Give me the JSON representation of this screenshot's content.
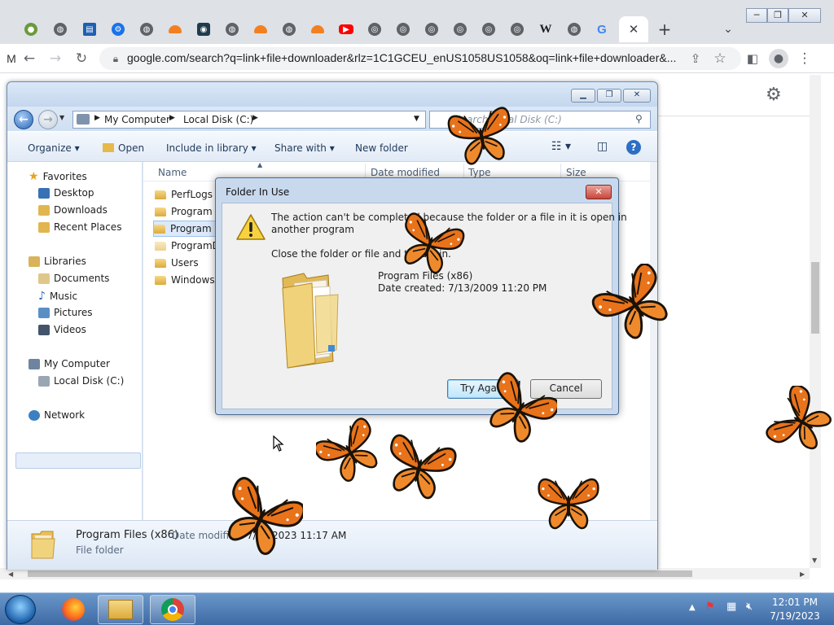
{
  "browser": {
    "url": "google.com/search?q=link+file+downloader&rlz=1C1GCEU_enUS1058US1058&oq=link+file+downloader&...",
    "tab_w_label": "W",
    "tab_g_label": "G",
    "partial_side_label": "M"
  },
  "explorer": {
    "breadcrumb": [
      "My Computer",
      "Local Disk (C:)"
    ],
    "search_placeholder": "Search Local Disk (C:)",
    "commands": {
      "organize": "Organize",
      "open": "Open",
      "include": "Include in library",
      "share": "Share with",
      "new_folder": "New folder"
    },
    "nav": {
      "favorites": "Favorites",
      "desktop": "Desktop",
      "downloads": "Downloads",
      "recent": "Recent Places",
      "libraries": "Libraries",
      "documents": "Documents",
      "music": "Music",
      "pictures": "Pictures",
      "videos": "Videos",
      "computer": "My Computer",
      "local_disk": "Local Disk (C:)",
      "network": "Network"
    },
    "columns": {
      "name": "Name",
      "date": "Date modified",
      "type": "Type",
      "size": "Size"
    },
    "files": [
      "PerfLogs",
      "Program",
      "Program",
      "ProgramD",
      "Users",
      "Windows"
    ],
    "details": {
      "name": "Program Files (x86)",
      "modified_label": "Date modified:",
      "modified_value": "7/19/2023 11:17 AM",
      "type": "File folder"
    }
  },
  "dialog": {
    "title": "Folder In Use",
    "message_line1": "The action can't be completed because the folder or a file in it is open in",
    "message_line2": "another program",
    "instruction": "Close the folder or file and try again.",
    "item_name": "Program Files (x86)",
    "item_date": "Date created: 7/13/2009 11:20 PM",
    "try_again": "Try Again",
    "cancel": "Cancel"
  },
  "taskbar": {
    "time": "12:01 PM",
    "date": "7/19/2023"
  },
  "colors": {
    "monarch_orange": "#e8731a",
    "accent_blue": "#3c7fb1"
  }
}
